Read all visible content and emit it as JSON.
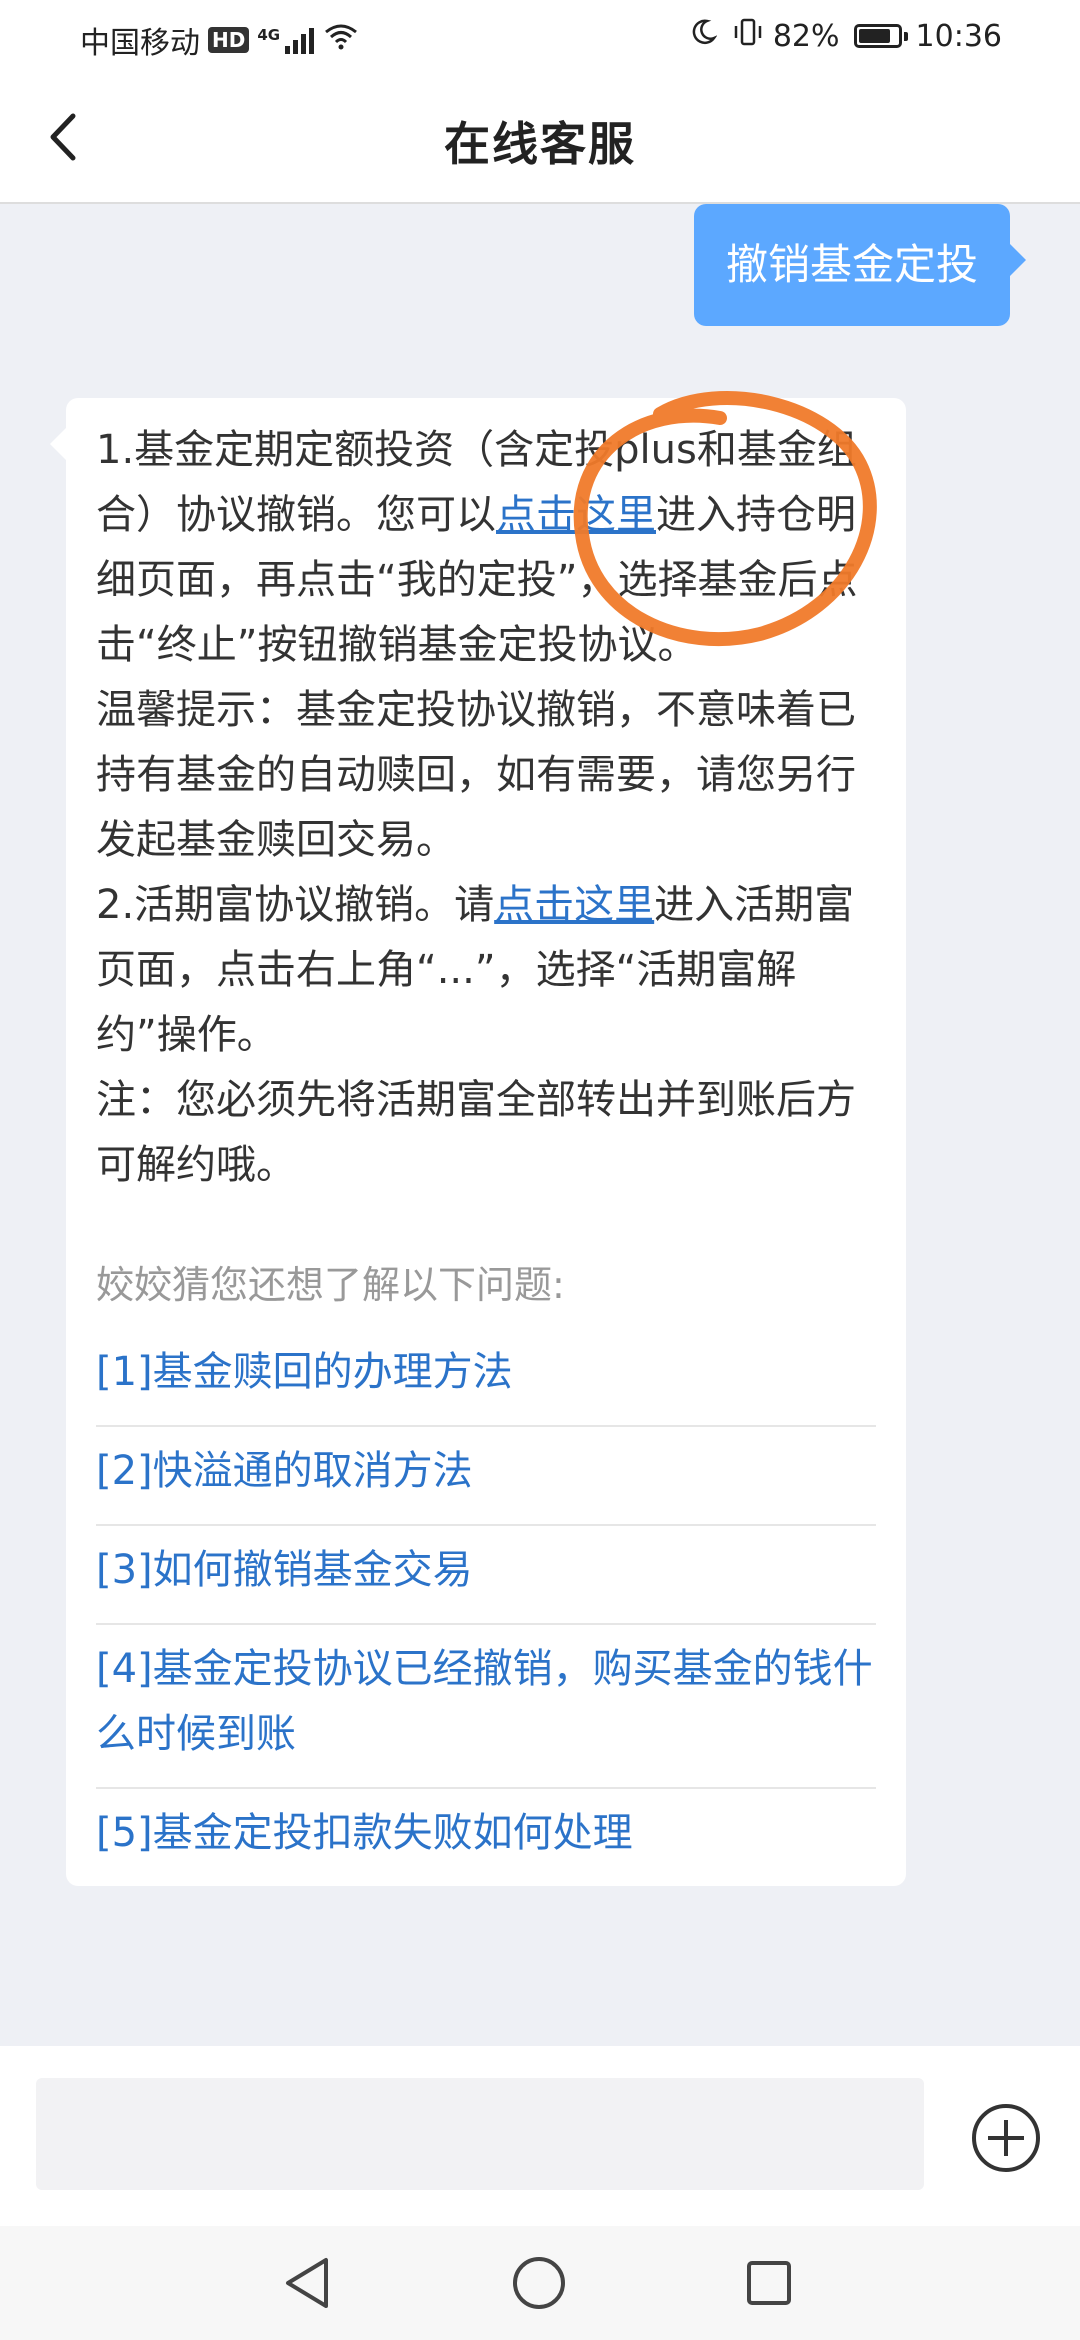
{
  "status_bar": {
    "carrier": "中国移动",
    "hd_badge": "HD",
    "network": "4G",
    "battery": "82%",
    "battery_level": 0.82,
    "time": "10:36"
  },
  "header": {
    "title": "在线客服"
  },
  "chat": {
    "user_message": "撤销基金定投",
    "bot": {
      "p1_a": "1.基金定期定额投资（含定投plus和基金组合）协议撤销。您可以",
      "p1_link": "点击这里",
      "p1_b": "进入持仓明细页面，再点击“我的定投”，选择基金后点击“终止”按钮撤销基金定投协议。",
      "tip": "温馨提示：基金定投协议撤销，不意味着已持有基金的自动赎回，如有需要，请您另行发起基金赎回交易。",
      "p2_a": "2.活期富协议撤销。请",
      "p2_link": "点击这里",
      "p2_b": "进入活期富页面，点击右上角“...”，选择“活期富解约”操作。",
      "note": "注：您必须先将活期富全部转出并到账后方可解约哦。",
      "suggest_intro": "姣姣猜您还想了解以下问题:",
      "suggestions": [
        "[1]基金赎回的办理方法",
        "[2]快溢通的取消方法",
        "[3]如何撤销基金交易",
        "[4]基金定投协议已经撤销，购买基金的钱什么时候到账",
        "[5]基金定投扣款失败如何处理"
      ]
    }
  },
  "input": {
    "placeholder": ""
  },
  "colors": {
    "user_bubble": "#5ca8ff",
    "link": "#2b73c9",
    "annotation": "#f07a2a",
    "background": "#eef0f5"
  }
}
